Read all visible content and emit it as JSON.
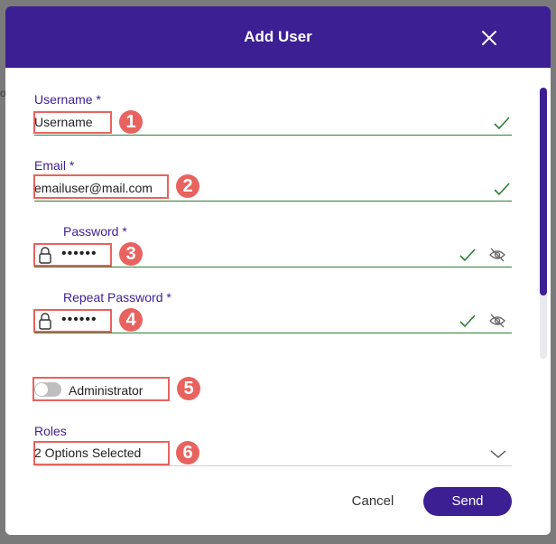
{
  "dialog": {
    "title": "Add User",
    "close_icon": "close-icon"
  },
  "fields": {
    "username": {
      "label": "Username *",
      "value": "Username",
      "status_icon": "check-icon"
    },
    "email": {
      "label": "Email *",
      "value": "emailuser@mail.com",
      "status_icon": "check-icon"
    },
    "password": {
      "label": "Password *",
      "value": "••••••",
      "leading_icon": "lock-icon",
      "status_icon": "check-icon",
      "toggle_icon": "eye-off-icon"
    },
    "repeat_password": {
      "label": "Repeat Password *",
      "value": "••••••",
      "leading_icon": "lock-icon",
      "status_icon": "check-icon",
      "toggle_icon": "eye-off-icon"
    },
    "administrator": {
      "label": "Administrator",
      "checked": false
    },
    "roles": {
      "label": "Roles",
      "value": "2 Options Selected",
      "dropdown_icon": "chevron-down-icon"
    }
  },
  "annotations": [
    "1",
    "2",
    "3",
    "4",
    "5",
    "6"
  ],
  "actions": {
    "cancel_label": "Cancel",
    "send_label": "Send"
  },
  "colors": {
    "primary": "#3c1f93",
    "valid": "#2e7d32",
    "annotation": "#e8635f",
    "overlay": "#7a7a7a"
  }
}
